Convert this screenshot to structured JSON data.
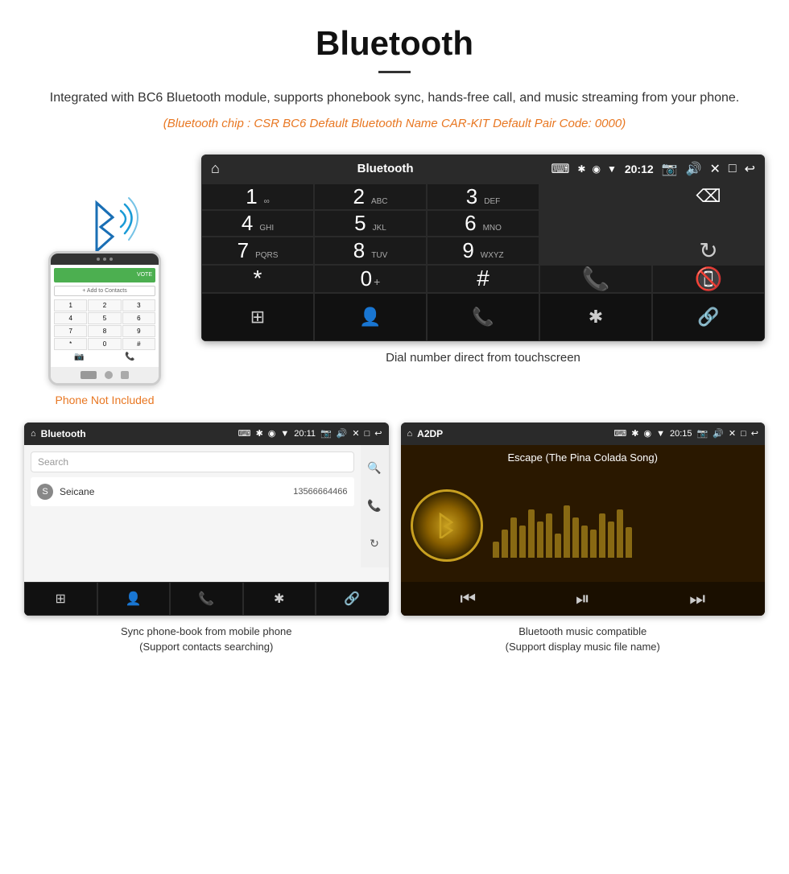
{
  "header": {
    "title": "Bluetooth",
    "description": "Integrated with BC6 Bluetooth module, supports phonebook sync, hands-free call, and music streaming from your phone.",
    "specs": "(Bluetooth chip : CSR BC6    Default Bluetooth Name CAR-KIT    Default Pair Code: 0000)"
  },
  "phone_note": "Phone Not Included",
  "car_screen_main": {
    "status_bar": {
      "title": "Bluetooth",
      "usb_icon": "⌨",
      "time": "20:12"
    },
    "dial_keys": [
      {
        "num": "1",
        "sub": "∞"
      },
      {
        "num": "2",
        "sub": "ABC"
      },
      {
        "num": "3",
        "sub": "DEF"
      },
      {
        "num": "",
        "sub": ""
      },
      {
        "num": "⌫",
        "sub": ""
      },
      {
        "num": "4",
        "sub": "GHI"
      },
      {
        "num": "5",
        "sub": "JKL"
      },
      {
        "num": "6",
        "sub": "MNO"
      },
      {
        "num": "",
        "sub": ""
      },
      {
        "num": "",
        "sub": ""
      },
      {
        "num": "7",
        "sub": "PQRS"
      },
      {
        "num": "8",
        "sub": "TUV"
      },
      {
        "num": "9",
        "sub": "WXYZ"
      },
      {
        "num": "",
        "sub": ""
      },
      {
        "num": "↻",
        "sub": ""
      },
      {
        "num": "*",
        "sub": ""
      },
      {
        "num": "0",
        "sub": "+"
      },
      {
        "num": "#",
        "sub": ""
      },
      {
        "num": "📞",
        "sub": ""
      },
      {
        "num": "📵",
        "sub": ""
      }
    ],
    "bottom_icons": [
      "⊞",
      "👤",
      "📞",
      "✱",
      "🔗"
    ]
  },
  "dial_caption": "Dial number direct from touchscreen",
  "phonebook_screen": {
    "status": {
      "title": "Bluetooth",
      "time": "20:11"
    },
    "search_placeholder": "Search",
    "contact": {
      "letter": "S",
      "name": "Seicane",
      "number": "13566664466"
    },
    "caption_line1": "Sync phone-book from mobile phone",
    "caption_line2": "(Support contacts searching)"
  },
  "music_screen": {
    "status": {
      "title": "A2DP",
      "time": "20:15"
    },
    "song_title": "Escape (The Pina Colada Song)",
    "bar_heights": [
      20,
      35,
      50,
      40,
      60,
      45,
      55,
      30,
      65,
      50,
      40,
      35,
      55,
      45,
      60,
      38
    ],
    "caption_line1": "Bluetooth music compatible",
    "caption_line2": "(Support display music file name)"
  }
}
